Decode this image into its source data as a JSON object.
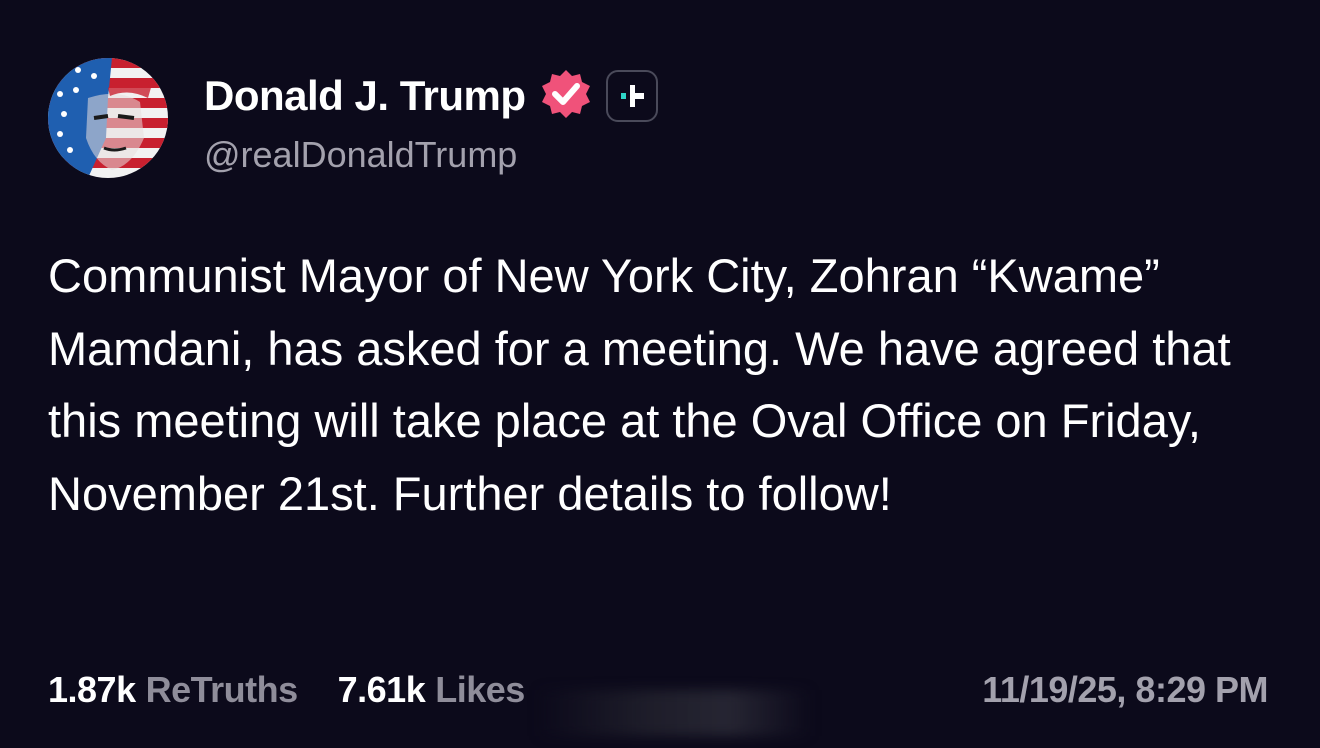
{
  "post": {
    "author": {
      "display_name": "Donald J. Trump",
      "handle": "@realDonaldTrump",
      "verified_icon": "verified-badge-icon",
      "follow_icon": "plus-icon",
      "avatar_icon": "flag-portrait-avatar"
    },
    "body": "Communist Mayor of New York City, Zohran “Kwame” Mamdani, has asked for a meeting. We have agreed that this meeting will take place at the Oval Office on Friday, November 21st. Further details to follow!",
    "stats": {
      "retruths_count": "1.87k",
      "retruths_label": "ReTruths",
      "likes_count": "7.61k",
      "likes_label": "Likes"
    },
    "timestamp": "11/19/25, 8:29 PM"
  },
  "colors": {
    "background": "#0c0a1b",
    "text_primary": "#ffffff",
    "text_secondary": "#a3a1ad",
    "verified_pink": "#f0527a",
    "follow_accent": "#2fd6c8"
  }
}
